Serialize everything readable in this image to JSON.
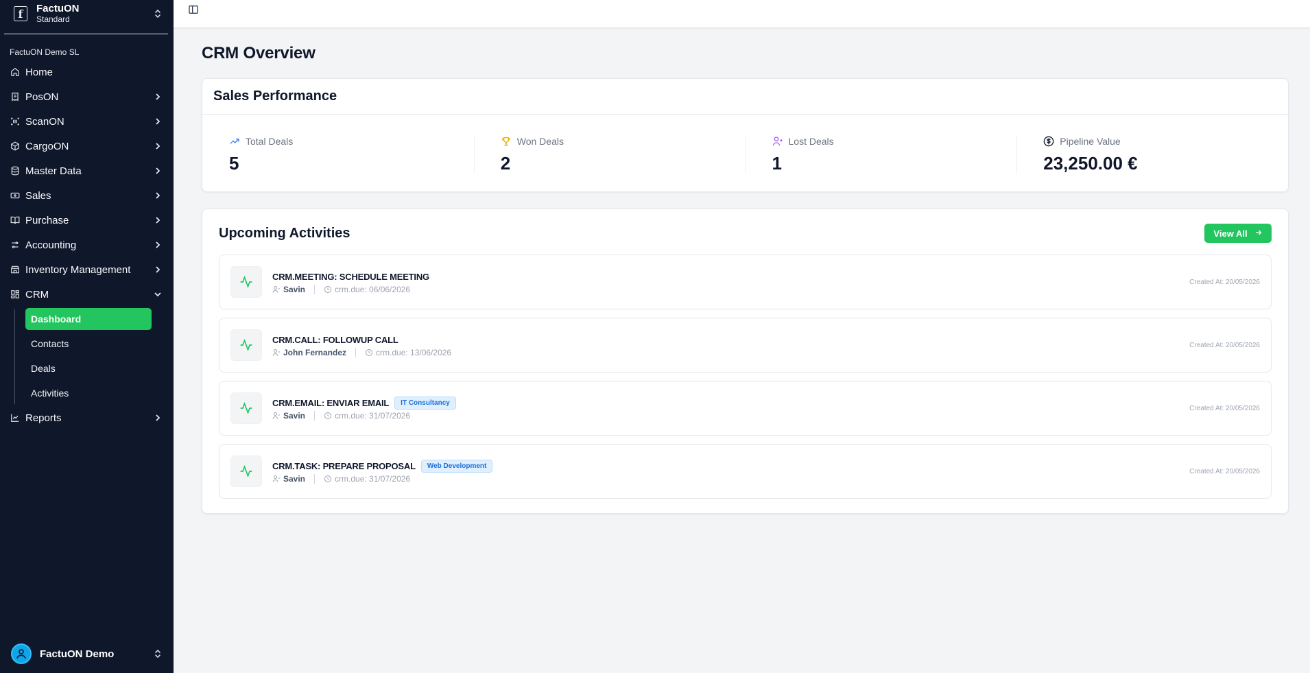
{
  "brand": {
    "name": "FactuON",
    "plan": "Standard",
    "logo_letter": "f"
  },
  "company": "FactuON Demo SL",
  "nav": [
    {
      "label": "Home",
      "icon": "home-icon",
      "chevron": false
    },
    {
      "label": "PosON",
      "icon": "receipt-icon",
      "chevron": true
    },
    {
      "label": "ScanON",
      "icon": "scan-icon",
      "chevron": true
    },
    {
      "label": "CargoON",
      "icon": "box-icon",
      "chevron": true
    },
    {
      "label": "Master Data",
      "icon": "database-icon",
      "chevron": true
    },
    {
      "label": "Sales",
      "icon": "banknote-icon",
      "chevron": true
    },
    {
      "label": "Purchase",
      "icon": "book-icon",
      "chevron": true
    },
    {
      "label": "Accounting",
      "icon": "sliders-icon",
      "chevron": true
    },
    {
      "label": "Inventory Management",
      "icon": "store-icon",
      "chevron": true
    },
    {
      "label": "CRM",
      "icon": "grid-icon",
      "chevron": true,
      "expanded": true
    }
  ],
  "crm_sub": [
    "Dashboard",
    "Contacts",
    "Deals",
    "Activities"
  ],
  "crm_active": "Dashboard",
  "reports": {
    "label": "Reports",
    "icon": "chart-icon"
  },
  "user": {
    "name": "FactuON Demo"
  },
  "page_title": "CRM Overview",
  "performance": {
    "title": "Sales Performance",
    "stats": [
      {
        "label": "Total Deals",
        "value": "5",
        "icon": "trending-up-icon",
        "color": "#3b82f6"
      },
      {
        "label": "Won Deals",
        "value": "2",
        "icon": "trophy-icon",
        "color": "#eab308"
      },
      {
        "label": "Lost Deals",
        "value": "1",
        "icon": "user-minus-icon",
        "color": "#a855f7"
      },
      {
        "label": "Pipeline Value",
        "value": "23,250.00 €",
        "icon": "dollar-circle-icon",
        "color": "#111827"
      }
    ]
  },
  "activities": {
    "title": "Upcoming Activities",
    "view_all": "View All",
    "items": [
      {
        "title": "CRM.MEETING: SCHEDULE MEETING",
        "tag": "",
        "who": "Savin",
        "due": "crm.due: 06/06/2026",
        "created": "Created At: 20/05/2026"
      },
      {
        "title": "CRM.CALL: FOLLOWUP CALL",
        "tag": "",
        "who": "John Fernandez",
        "due": "crm.due: 13/06/2026",
        "created": "Created At: 20/05/2026"
      },
      {
        "title": "CRM.EMAIL: ENVIAR EMAIL",
        "tag": "IT Consultancy",
        "who": "Savin",
        "due": "crm.due: 31/07/2026",
        "created": "Created At: 20/05/2026"
      },
      {
        "title": "CRM.TASK: PREPARE PROPOSAL",
        "tag": "Web Development",
        "who": "Savin",
        "due": "crm.due: 31/07/2026",
        "created": "Created At: 20/05/2026"
      }
    ]
  },
  "colors": {
    "accent": "#22c55e",
    "sidebar": "#0f172a",
    "background": "#f3f4f6"
  }
}
